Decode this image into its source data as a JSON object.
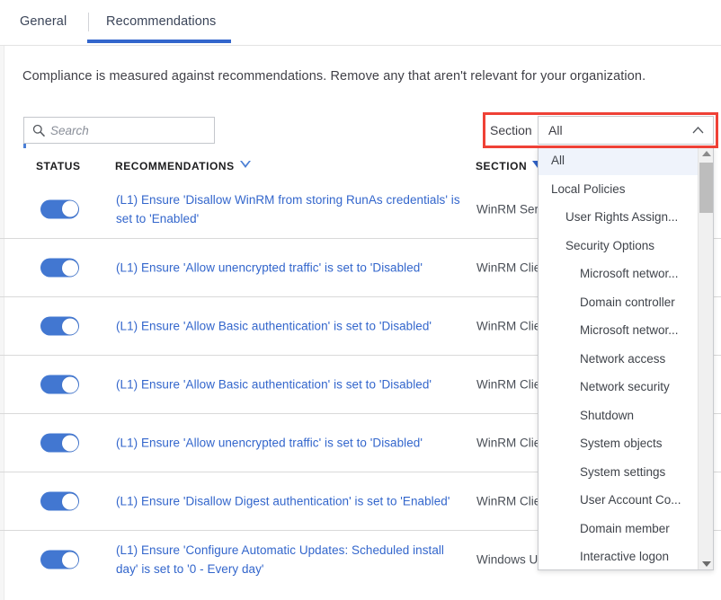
{
  "tabs": {
    "general": "General",
    "recommendations": "Recommendations"
  },
  "description": "Compliance is measured against recommendations. Remove any that aren't relevant for your organization.",
  "search": {
    "placeholder": "Search",
    "value": "",
    "icon": "search-icon"
  },
  "section_filter": {
    "label": "Section",
    "selected": "All",
    "caret_icon": "chevron-up-icon",
    "highlight_color": "#ef4136"
  },
  "table": {
    "headers": {
      "status": "STATUS",
      "recommendations": "RECOMMENDATIONS",
      "section": "SECTION"
    },
    "rows": [
      {
        "toggle": "on",
        "recommendation": "(L1) Ensure 'Disallow WinRM from storing RunAs credentials' is set to 'Enabled'",
        "section": "WinRM Serv"
      },
      {
        "toggle": "on",
        "recommendation": "(L1) Ensure 'Allow unencrypted traffic' is set to 'Disabled'",
        "section": "WinRM Clie"
      },
      {
        "toggle": "on",
        "recommendation": "(L1) Ensure 'Allow Basic authentication' is set to 'Disabled'",
        "section": "WinRM Clie"
      },
      {
        "toggle": "on",
        "recommendation": "(L1) Ensure 'Allow Basic authentication' is set to 'Disabled'",
        "section": "WinRM Clie"
      },
      {
        "toggle": "on",
        "recommendation": "(L1) Ensure 'Allow unencrypted traffic' is set to 'Disabled'",
        "section": "WinRM Clie"
      },
      {
        "toggle": "on",
        "recommendation": "(L1) Ensure 'Disallow Digest authentication' is set to 'Enabled'",
        "section": "WinRM Clie"
      },
      {
        "toggle": "on",
        "recommendation": "(L1) Ensure 'Configure Automatic Updates: Scheduled install day' is set to '0 - Every day'",
        "section": "Windows U"
      }
    ]
  },
  "dropdown": {
    "open": true,
    "items": [
      {
        "label": "All",
        "level": 0,
        "selected": true
      },
      {
        "label": "Local Policies",
        "level": 0,
        "selected": false
      },
      {
        "label": "User Rights Assign...",
        "level": 1,
        "selected": false
      },
      {
        "label": "Security Options",
        "level": 1,
        "selected": false
      },
      {
        "label": "Microsoft networ...",
        "level": 2,
        "selected": false
      },
      {
        "label": "Domain controller",
        "level": 2,
        "selected": false
      },
      {
        "label": "Microsoft networ...",
        "level": 2,
        "selected": false
      },
      {
        "label": "Network access",
        "level": 2,
        "selected": false
      },
      {
        "label": "Network security",
        "level": 2,
        "selected": false
      },
      {
        "label": "Shutdown",
        "level": 2,
        "selected": false
      },
      {
        "label": "System objects",
        "level": 2,
        "selected": false
      },
      {
        "label": "System settings",
        "level": 2,
        "selected": false
      },
      {
        "label": "User Account Co...",
        "level": 2,
        "selected": false
      },
      {
        "label": "Domain member",
        "level": 2,
        "selected": false
      },
      {
        "label": "Interactive logon",
        "level": 2,
        "selected": false
      }
    ],
    "scrollbar": {
      "up_icon": "scroll-up-arrow-icon",
      "down_icon": "scroll-down-arrow-icon"
    }
  },
  "colors": {
    "accent": "#3366cc",
    "toggle_on": "#4277d1",
    "link": "#3366cc",
    "highlight": "#ef4136"
  }
}
